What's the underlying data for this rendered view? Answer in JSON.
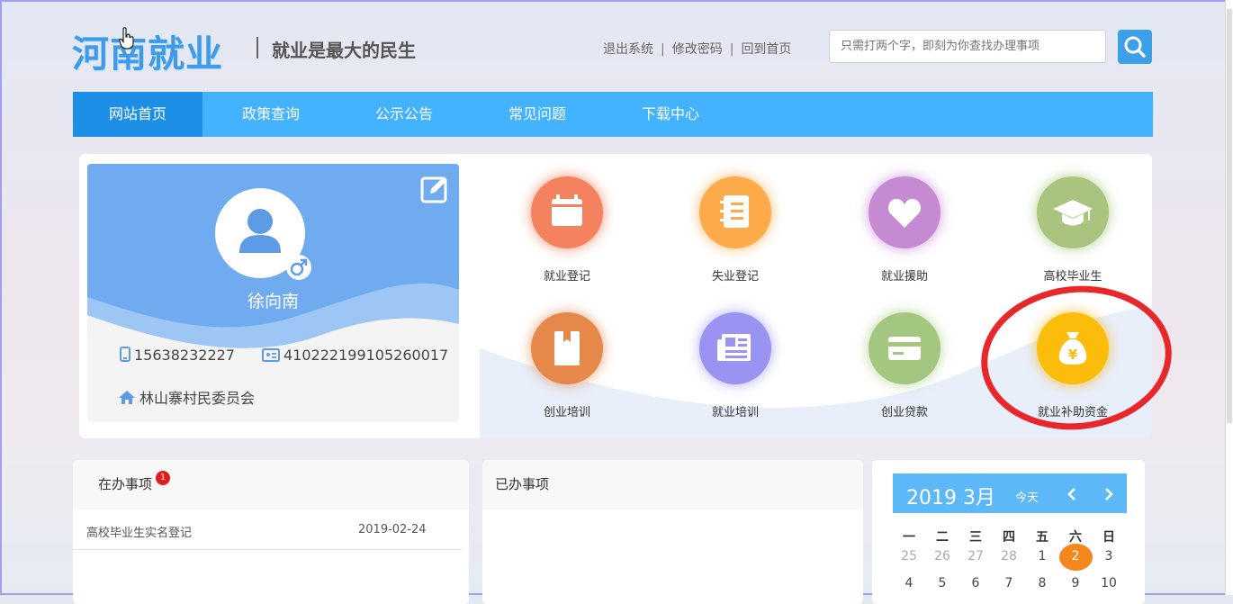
{
  "header": {
    "logo": "河南就业",
    "slogan": "就业是最大的民生",
    "links": [
      "退出系统",
      "修改密码",
      "回到首页"
    ],
    "search_placeholder": "只需打两个字，即刻为你查找办理事项"
  },
  "nav": {
    "items": [
      "网站首页",
      "政策查询",
      "公示公告",
      "常见问题",
      "下载中心"
    ],
    "active": "网站首页"
  },
  "profile": {
    "name": "徐向南",
    "phone": "15638232227",
    "id_number": "410222199105260017",
    "org": "林山寨村民委员会"
  },
  "services": [
    {
      "label": "就业登记",
      "icon": "calendar-icon",
      "color": "#f5825f"
    },
    {
      "label": "失业登记",
      "icon": "notebook-icon",
      "color": "#fdab4a"
    },
    {
      "label": "就业援助",
      "icon": "heart-icon",
      "color": "#c58ad2"
    },
    {
      "label": "高校毕业生",
      "icon": "graduation-cap-icon",
      "color": "#a8c47e"
    },
    {
      "label": "创业培训",
      "icon": "book-icon",
      "color": "#e6884a"
    },
    {
      "label": "就业培训",
      "icon": "newspaper-icon",
      "color": "#9a93f2"
    },
    {
      "label": "创业贷款",
      "icon": "card-icon",
      "color": "#a3c77e"
    },
    {
      "label": "就业补助资金",
      "icon": "money-bag-icon",
      "color": "#fbbc0b"
    }
  ],
  "pending": {
    "title": "在办事项",
    "badge": "1",
    "items": [
      {
        "name": "高校毕业生实名登记",
        "date": "2019-02-24"
      }
    ]
  },
  "done": {
    "title": "已办事项"
  },
  "calendar": {
    "title": "2019 3月",
    "today_label": "今天",
    "weekdays": [
      "一",
      "二",
      "三",
      "四",
      "五",
      "六",
      "日"
    ],
    "row1": [
      "25",
      "26",
      "27",
      "28",
      "1",
      "2",
      "3"
    ],
    "row2": [
      "4",
      "5",
      "6",
      "7",
      "8",
      "9",
      "10"
    ],
    "selected_day": "2"
  },
  "colors": {
    "accent": "#43b2ff",
    "nav_active": "#1e8fe6",
    "highlight_ring": "#e8272b",
    "today": "#f4881d"
  }
}
